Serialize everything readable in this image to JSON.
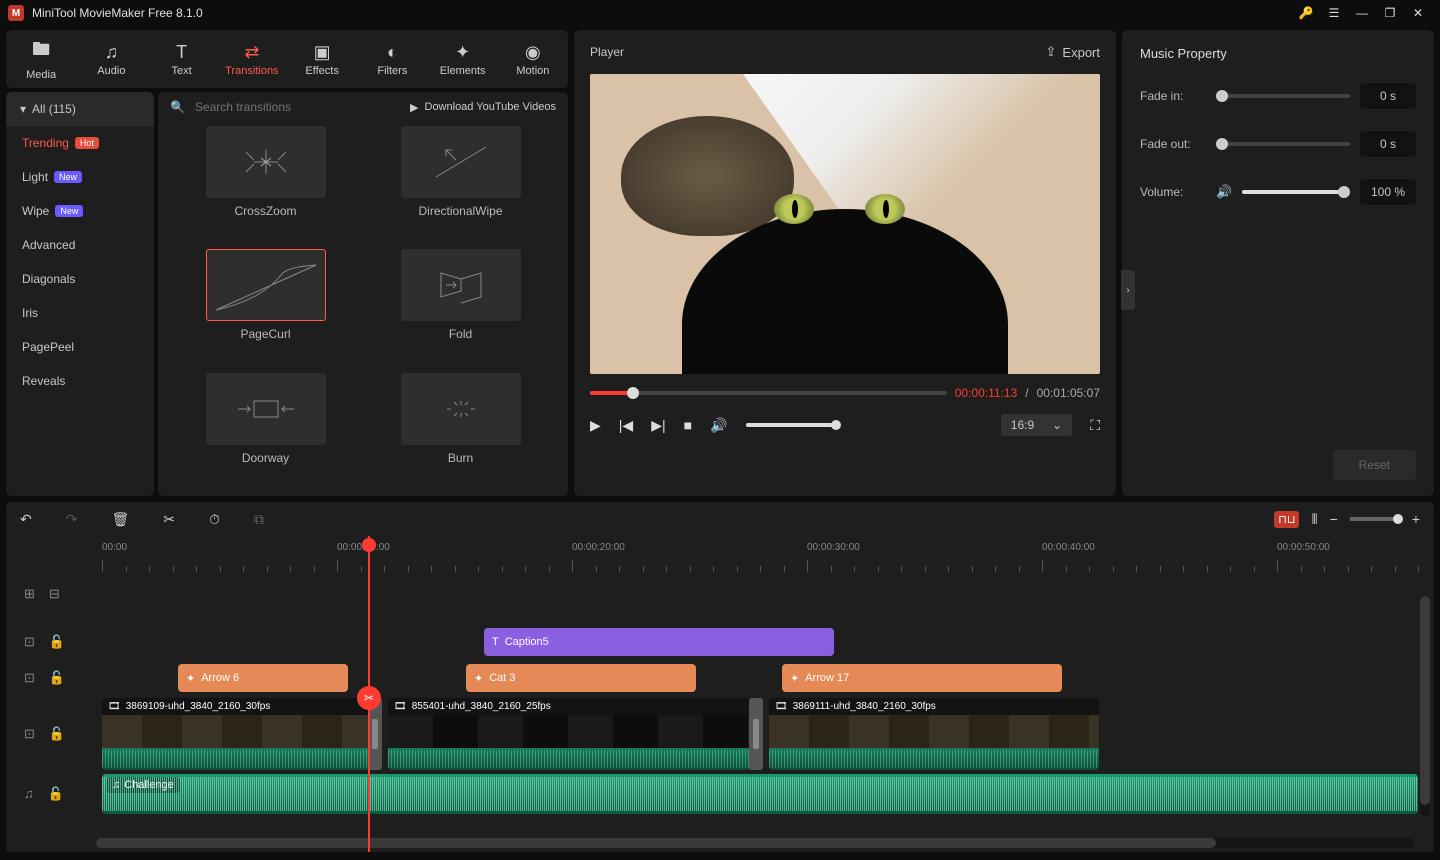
{
  "title": "MiniTool MovieMaker Free 8.1.0",
  "tabs": {
    "media": "Media",
    "audio": "Audio",
    "text": "Text",
    "transitions": "Transitions",
    "effects": "Effects",
    "filters": "Filters",
    "elements": "Elements",
    "motion": "Motion"
  },
  "sidebar": {
    "header": "All (115)",
    "items": [
      {
        "label": "Trending",
        "badge": "Hot",
        "badgeClass": "hot"
      },
      {
        "label": "Light",
        "badge": "New",
        "badgeClass": "new"
      },
      {
        "label": "Wipe",
        "badge": "New",
        "badgeClass": "new"
      },
      {
        "label": "Advanced"
      },
      {
        "label": "Diagonals"
      },
      {
        "label": "Iris"
      },
      {
        "label": "PagePeel"
      },
      {
        "label": "Reveals"
      }
    ]
  },
  "search_placeholder": "Search transitions",
  "download_link": "Download YouTube Videos",
  "transitions": [
    "CrossZoom",
    "DirectionalWipe",
    "PageCurl",
    "Fold",
    "Doorway",
    "Burn"
  ],
  "player": {
    "title": "Player",
    "export": "Export",
    "cur": "00:00:11:13",
    "sep": " / ",
    "dur": "00:01:05:07",
    "ratio": "16:9"
  },
  "props": {
    "title": "Music Property",
    "fadein_label": "Fade in:",
    "fadein_val": "0 s",
    "fadeout_label": "Fade out:",
    "fadeout_val": "0 s",
    "volume_label": "Volume:",
    "volume_val": "100 %",
    "reset": "Reset"
  },
  "ruler": [
    "00:00",
    "00:00:10:00",
    "00:00:20:00",
    "00:00:30:00",
    "00:00:40:00",
    "00:00:50:00"
  ],
  "clips": {
    "caption": "Caption5",
    "eff1": "Arrow 6",
    "eff2": "Cat 3",
    "eff3": "Arrow 17",
    "vid1": "3869109-uhd_3840_2160_30fps",
    "vid2": "855401-uhd_3840_2160_25fps",
    "vid3": "3869111-uhd_3840_2160_30fps",
    "audio": "Challenge"
  }
}
